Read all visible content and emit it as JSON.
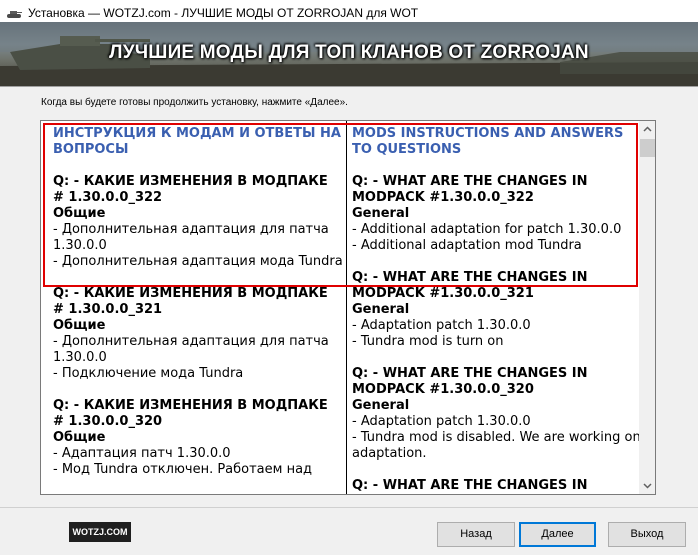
{
  "window": {
    "title": "Установка — WOTZJ.com - ЛУЧШИЕ МОДЫ ОТ ZORROJAN для WOT"
  },
  "banner": {
    "title": "ЛУЧШИЕ МОДЫ ДЛЯ ТОП КЛАНОВ ОТ ZORROJAN"
  },
  "instruction": "Когда вы будете готовы продолжить установку, нажмите «Далее».",
  "left_column": [
    {
      "type": "heading",
      "text": "ИНСТРУКЦИЯ К МОДАМ И ОТВЕТЫ НА ВОПРОСЫ"
    },
    {
      "type": "gap"
    },
    {
      "type": "q",
      "text": "Q: - КАКИЕ ИЗМЕНЕНИЯ В МОДПАКЕ # 1.30.0.0_322"
    },
    {
      "type": "sub",
      "text": "Общие"
    },
    {
      "type": "item",
      "text": "- Дополнительная адаптация для патча 1.30.0.0"
    },
    {
      "type": "item",
      "text": "- Дополнительная адаптация мода Tundra"
    },
    {
      "type": "gap"
    },
    {
      "type": "q",
      "text": "Q: - КАКИЕ ИЗМЕНЕНИЯ В МОДПАКЕ # 1.30.0.0_321"
    },
    {
      "type": "sub",
      "text": "Общие"
    },
    {
      "type": "item",
      "text": "- Дополнительная адаптация для патча 1.30.0.0"
    },
    {
      "type": "item",
      "text": "- Подключение мода Tundra"
    },
    {
      "type": "gap"
    },
    {
      "type": "q",
      "text": "Q: - КАКИЕ ИЗМЕНЕНИЯ В МОДПАКЕ # 1.30.0.0_320"
    },
    {
      "type": "sub",
      "text": "Общие"
    },
    {
      "type": "item",
      "text": "- Адаптация патч 1.30.0.0"
    },
    {
      "type": "item",
      "text": "- Мод Tundra отключен. Работаем над"
    }
  ],
  "right_column": [
    {
      "type": "heading",
      "text": "MODS INSTRUCTIONS AND ANSWERS TO QUESTIONS"
    },
    {
      "type": "gap"
    },
    {
      "type": "q",
      "text": "Q: - WHAT ARE THE CHANGES IN MODPACK #1.30.0.0_322"
    },
    {
      "type": "sub",
      "text": "General"
    },
    {
      "type": "item",
      "text": "- Additional adaptation for patch 1.30.0.0"
    },
    {
      "type": "item",
      "text": "- Additional adaptation mod Tundra"
    },
    {
      "type": "gap"
    },
    {
      "type": "q",
      "text": "Q: - WHAT ARE THE CHANGES IN MODPACK #1.30.0.0_321"
    },
    {
      "type": "sub",
      "text": "General"
    },
    {
      "type": "item",
      "text": "- Adaptation patch 1.30.0.0"
    },
    {
      "type": "item",
      "text": "- Tundra mod is turn on"
    },
    {
      "type": "gap"
    },
    {
      "type": "q",
      "text": "Q: - WHAT ARE THE CHANGES IN MODPACK #1.30.0.0_320"
    },
    {
      "type": "sub",
      "text": "General"
    },
    {
      "type": "item",
      "text": "- Adaptation patch 1.30.0.0"
    },
    {
      "type": "item",
      "text": "- Tundra mod is disabled. We are working on adaptation."
    },
    {
      "type": "gap"
    },
    {
      "type": "q",
      "text": "Q: - WHAT ARE THE CHANGES IN"
    }
  ],
  "footer": {
    "logo_text": "WOTZJ.COM",
    "back_label": "Назад",
    "next_label": "Далее",
    "exit_label": "Выход"
  },
  "colors": {
    "heading": "#3a5fb0",
    "highlight_border": "#e00000",
    "default_button_border": "#0078d7"
  },
  "icons": {
    "window": "tank-icon",
    "scroll_up": "chevron-up-icon",
    "scroll_down": "chevron-down-icon"
  }
}
